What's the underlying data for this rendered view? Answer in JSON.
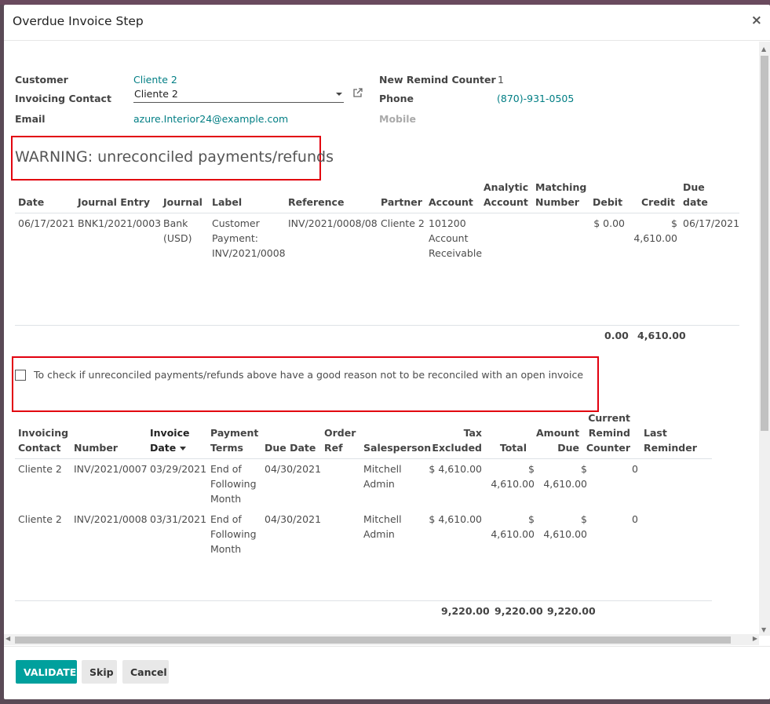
{
  "dialog": {
    "title": "Overdue Invoice Step",
    "close": "×"
  },
  "form": {
    "customer_label": "Customer",
    "customer_value": "Cliente 2",
    "contact_label": "Invoicing Contact",
    "contact_value": "Cliente 2",
    "email_label": "Email",
    "email_value": "azure.Interior24@example.com",
    "remind_label": "New Remind Counter",
    "remind_value": "1",
    "phone_label": "Phone",
    "phone_value": "(870)-931-0505",
    "mobile_label": "Mobile"
  },
  "warning": {
    "text": "WARNING: unreconciled payments/refunds"
  },
  "payments": {
    "headers": {
      "date": "Date",
      "journal_entry": "Journal Entry",
      "journal": "Journal",
      "label": "Label",
      "reference": "Reference",
      "partner": "Partner",
      "account": "Account",
      "analytic_1": "Analytic",
      "analytic_2": "Account",
      "matching_1": "Matching",
      "matching_2": "Number",
      "debit": "Debit",
      "credit": "Credit",
      "due_1": "Due",
      "due_2": "date"
    },
    "row": {
      "date": "06/17/2021",
      "journal_entry": "BNK1/2021/0003",
      "journal_1": "Bank",
      "journal_2": "(USD)",
      "label_1": "Customer",
      "label_2": "Payment:",
      "label_3": "INV/2021/0008",
      "reference": "INV/2021/0008/08",
      "partner": "Cliente 2",
      "account_1": "101200",
      "account_2": "Account",
      "account_3": "Receivable",
      "debit": "$ 0.00",
      "credit": "$ 4,610.00",
      "due": "06/17/2021"
    },
    "totals": {
      "debit": "0.00",
      "credit": "4,610.00"
    }
  },
  "check": {
    "label": "To check if unreconciled payments/refunds above have a good reason not to be reconciled with an open invoice"
  },
  "invoices": {
    "headers": {
      "contact_1": "Invoicing",
      "contact_2": "Contact",
      "number": "Number",
      "date_1": "Invoice",
      "date_2": "Date",
      "terms_1": "Payment",
      "terms_2": "Terms",
      "due_date": "Due Date",
      "order_1": "Order",
      "order_2": "Ref",
      "salesperson": "Salesperson",
      "tax_1": "Tax",
      "tax_2": "Excluded",
      "total": "Total",
      "amount_1": "Amount",
      "amount_2": "Due",
      "counter_1": "Current",
      "counter_2": "Remind",
      "counter_3": "Counter",
      "last_1": "Last",
      "last_2": "Reminder"
    },
    "rows": [
      {
        "contact": "Cliente 2",
        "number": "INV/2021/0007",
        "date": "03/29/2021",
        "terms_1": "End of",
        "terms_2": "Following",
        "terms_3": "Month",
        "due": "04/30/2021",
        "sales_1": "Mitchell",
        "sales_2": "Admin",
        "tax": "$ 4,610.00",
        "total": "$ 4,610.00",
        "amount": "$ 4,610.00",
        "counter": "0"
      },
      {
        "contact": "Cliente 2",
        "number": "INV/2021/0008",
        "date": "03/31/2021",
        "terms_1": "End of",
        "terms_2": "Following",
        "terms_3": "Month",
        "due": "04/30/2021",
        "sales_1": "Mitchell",
        "sales_2": "Admin",
        "tax": "$ 4,610.00",
        "total": "$ 4,610.00",
        "amount": "$ 4,610.00",
        "counter": "0"
      }
    ],
    "totals": {
      "tax": "9,220.00",
      "total": "9,220.00",
      "amount": "9,220.00"
    }
  },
  "footer": {
    "validate": "VALIDATE",
    "skip": "Skip",
    "cancel": "Cancel"
  },
  "colors": {
    "accent": "#00a09d",
    "link": "#017e84",
    "highlight": "#e2000f"
  }
}
